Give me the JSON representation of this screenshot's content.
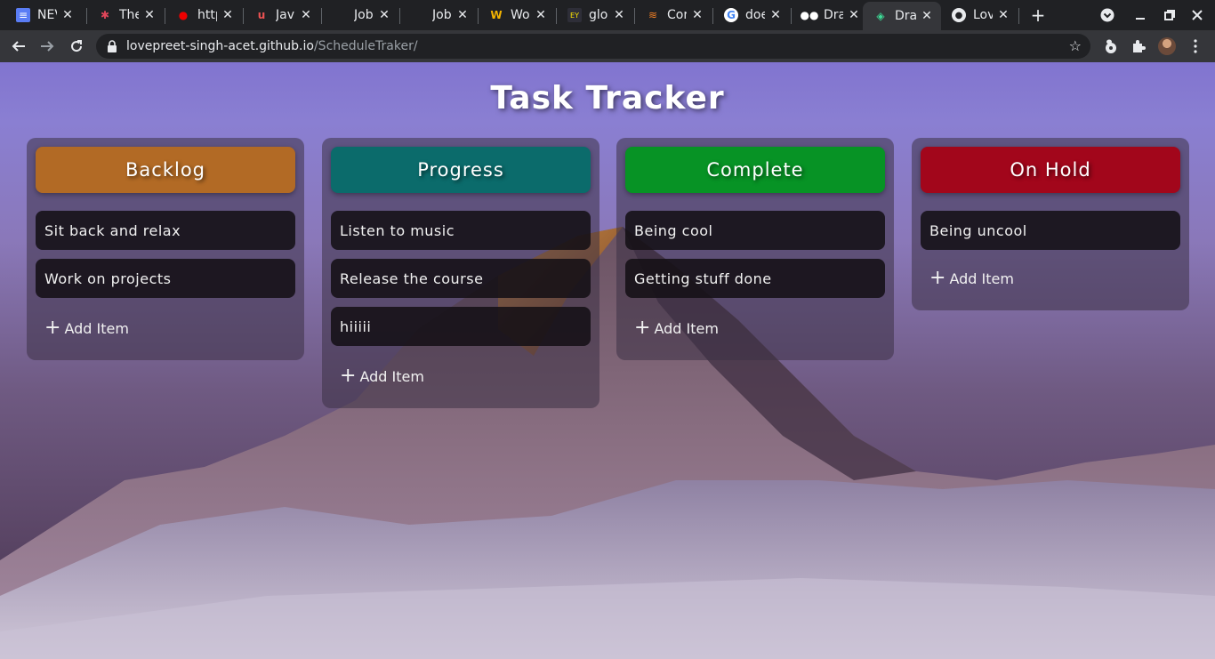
{
  "browser": {
    "tabs": [
      {
        "label": "NEV",
        "icon": "docs-icon"
      },
      {
        "label": "The",
        "icon": "asterisk-icon"
      },
      {
        "label": "http",
        "icon": "redhat-icon"
      },
      {
        "label": "Jav",
        "icon": "udemy-icon"
      },
      {
        "label": "Job",
        "icon": "blank-icon"
      },
      {
        "label": "Job",
        "icon": "blank-icon"
      },
      {
        "label": "Wo",
        "icon": "w-icon"
      },
      {
        "label": "glo",
        "icon": "ey-icon"
      },
      {
        "label": "Cor",
        "icon": "stack-icon"
      },
      {
        "label": "doe",
        "icon": "google-icon"
      },
      {
        "label": "Dra",
        "icon": "medium-icon"
      },
      {
        "label": "Dra",
        "icon": "layers-icon",
        "active": true
      },
      {
        "label": "Lov",
        "icon": "github-icon"
      }
    ],
    "url_host": "lovepreet-singh-acet.github.io",
    "url_path": "/ScheduleTraker/"
  },
  "app": {
    "title": "Task Tracker",
    "add_item_label": "Add Item",
    "columns": [
      {
        "name": "Backlog",
        "color": "#b26a25",
        "items": [
          "Sit back and relax",
          "Work on projects"
        ]
      },
      {
        "name": "Progress",
        "color": "#0b6b6b",
        "items": [
          "Listen to music",
          "Release the course",
          "hiiiii"
        ]
      },
      {
        "name": "Complete",
        "color": "#079325",
        "items": [
          "Being cool",
          "Getting stuff done"
        ]
      },
      {
        "name": "On Hold",
        "color": "#a2061b",
        "items": [
          "Being uncool"
        ]
      }
    ]
  }
}
